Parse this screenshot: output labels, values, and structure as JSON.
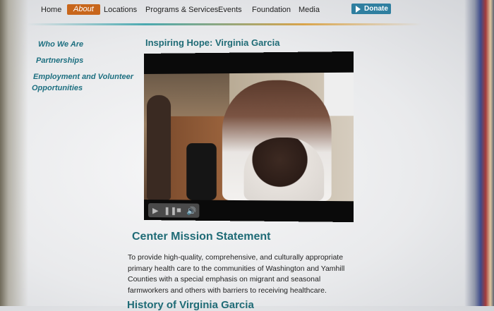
{
  "nav": {
    "items": [
      {
        "label": "Home"
      },
      {
        "label": "About",
        "active": true
      },
      {
        "label": "Locations"
      },
      {
        "label": "Programs & Services"
      },
      {
        "label": "Events"
      },
      {
        "label": "Foundation"
      },
      {
        "label": "Media"
      }
    ],
    "donate_label": "Donate"
  },
  "sidebar": {
    "items": [
      {
        "label": "Who We Are"
      },
      {
        "label": "Partnerships"
      },
      {
        "label_line1": "Employment and Volunteer",
        "label_line2": "Opportunities"
      }
    ]
  },
  "main": {
    "title": "Inspiring Hope: Virginia Garcia",
    "mission_heading": "Center Mission Statement",
    "mission_text": "To provide high-quality, comprehensive, and culturally appropriate primary health care to the communities of Washington and Yamhill Counties with a special emphasis on migrant and seasonal farmworkers and others with barriers to receiving healthcare.",
    "next_heading": "History of Virginia Garcia"
  },
  "colors": {
    "accent": "#c8661b",
    "heading": "#1f6b76",
    "donate": "#2f7fa0"
  }
}
